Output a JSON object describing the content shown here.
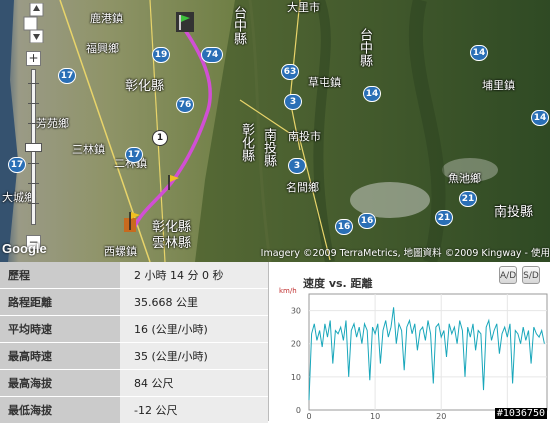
{
  "map": {
    "labels": [
      {
        "text": "鹿港鎮",
        "cls": ""
      },
      {
        "text": "福興鄉",
        "cls": ""
      },
      {
        "text": "彰化縣",
        "cls": "county"
      },
      {
        "text": "芳苑鄉",
        "cls": ""
      },
      {
        "text": "二林鎮",
        "cls": ""
      },
      {
        "text": "三林鎮",
        "cls": ""
      },
      {
        "text": "大城鄉",
        "cls": ""
      },
      {
        "text": "西螺鎮",
        "cls": ""
      },
      {
        "text": "雲林縣",
        "cls": "county"
      },
      {
        "text": "彰化縣",
        "cls": "county"
      },
      {
        "text": "大里市",
        "cls": ""
      },
      {
        "text": "草屯鎮",
        "cls": ""
      },
      {
        "text": "南投市",
        "cls": ""
      },
      {
        "text": "名間鄉",
        "cls": ""
      },
      {
        "text": "南投縣",
        "cls": "county"
      },
      {
        "text": "埔里鎮",
        "cls": ""
      },
      {
        "text": "魚池鄉",
        "cls": ""
      },
      {
        "text": "台中縣",
        "cls": "county"
      },
      {
        "text": "台中縣",
        "cls": "county"
      },
      {
        "text": "彰化縣",
        "cls": "county"
      },
      {
        "text": "南投縣",
        "cls": "county"
      }
    ],
    "shields": [
      "19",
      "74",
      "76",
      "1",
      "17",
      "17",
      "63",
      "14",
      "3",
      "3",
      "16",
      "14",
      "14",
      "21",
      "21",
      "16",
      "17"
    ],
    "copyright": "Imagery ©2009 TerraMetrics, 地圖資料 ©2009 Kingway - 使用",
    "google": "Google",
    "zoom_in": "+",
    "zoom_out": "−"
  },
  "stats": [
    {
      "label": "歷程",
      "value": "2 小時 14 分 0 秒"
    },
    {
      "label": "路程距離",
      "value": "35.668 公里"
    },
    {
      "label": "平均時速",
      "value": "16 (公里/小時)"
    },
    {
      "label": "最高時速",
      "value": "35 (公里/小時)"
    },
    {
      "label": "最高海拔",
      "value": "84 公尺"
    },
    {
      "label": "最低海拔",
      "value": "-12 公尺"
    }
  ],
  "chart_panel": {
    "title": "速度 vs. 距離",
    "btn_ad": "A/D",
    "btn_sd": "S/D",
    "watermark": "#1036750"
  },
  "chart_data": {
    "type": "line",
    "title": "速度 vs. 距離",
    "ylabel": "km/h",
    "xlabel": "",
    "ylim": [
      0,
      35
    ],
    "xlim": [
      0,
      36
    ],
    "yticks": [
      0,
      10,
      20,
      30
    ],
    "xticks": [
      0,
      10,
      20,
      30
    ],
    "line_color": "#19a7bb",
    "series": [
      {
        "x": [
          0,
          0.4,
          0.8,
          1.2,
          1.6,
          2,
          2.4,
          2.8,
          3.2,
          3.6,
          4,
          4.4,
          4.8,
          5.2,
          5.6,
          6,
          6.4,
          6.8,
          7.2,
          7.6,
          8,
          8.4,
          8.8,
          9.2,
          9.6,
          10,
          10.4,
          10.8,
          11.2,
          11.6,
          12,
          12.4,
          12.8,
          13.2,
          13.6,
          14,
          14.4,
          14.8,
          15.2,
          15.6,
          16,
          16.4,
          16.8,
          17.2,
          17.6,
          18,
          18.4,
          18.8,
          19.2,
          19.6,
          20,
          20.4,
          20.8,
          21.2,
          21.6,
          22,
          22.4,
          22.8,
          23.2,
          23.6,
          24,
          24.4,
          24.8,
          25.2,
          25.6,
          26,
          26.4,
          26.8,
          27.2,
          27.6,
          28,
          28.4,
          28.8,
          29.2,
          29.6,
          30,
          30.4,
          30.8,
          31.2,
          31.6,
          32,
          32.4,
          32.8,
          33.2,
          33.6,
          34,
          34.4,
          34.8,
          35.2,
          35.6
        ],
        "values": [
          3,
          23,
          26,
          21,
          24,
          19,
          26,
          22,
          27,
          14,
          24,
          23,
          25,
          21,
          27,
          10,
          24,
          26,
          22,
          25,
          20,
          26,
          24,
          9,
          25,
          23,
          26,
          14,
          24,
          27,
          22,
          25,
          31,
          20,
          26,
          24,
          12,
          25,
          27,
          23,
          26,
          18,
          24,
          25,
          21,
          27,
          23,
          8,
          25,
          26,
          22,
          24,
          16,
          26,
          23,
          25,
          20,
          27,
          24,
          10,
          25,
          22,
          26,
          18,
          24,
          23,
          6,
          25,
          27,
          21,
          24,
          26,
          17,
          23,
          25,
          22,
          26,
          8,
          24,
          23,
          20,
          25,
          21,
          24,
          14,
          25,
          23,
          22,
          24,
          20
        ]
      }
    ]
  }
}
